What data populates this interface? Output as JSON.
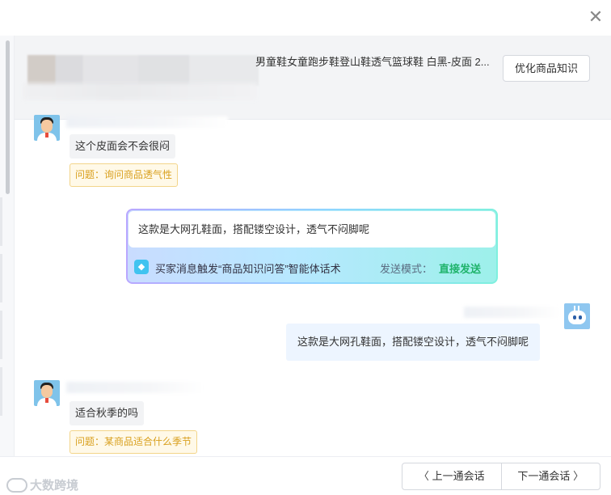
{
  "window": {
    "close_glyph": "✕"
  },
  "product": {
    "title": "男童鞋女童跑步鞋登山鞋透气篮球鞋 白黑-皮面 2...",
    "optimize_button": "优化商品知识"
  },
  "messages": [
    {
      "role": "customer",
      "text": "这个皮面会不会很闷",
      "tag": "问题：询问商品透气性"
    },
    {
      "role": "agent",
      "text": "这款是大网孔鞋面，搭配镂空设计，透气不闷脚呢"
    },
    {
      "role": "customer",
      "text": "适合秋季的吗",
      "tag": "问题：某商品适合什么季节"
    }
  ],
  "ai_suggestion": {
    "text": "这款是大网孔鞋面，搭配镂空设计，透气不闷脚呢",
    "trigger": "买家消息触发“商品知识问答”智能体话术",
    "mode_label": "发送模式：",
    "mode_value": "直接发送",
    "icon": "robot-icon"
  },
  "footer": {
    "prev_label": "上一通会话",
    "next_label": "下一通会话",
    "prev_glyph": "〈",
    "next_glyph": "〉",
    "watermark": "大数跨境"
  },
  "colors": {
    "tag_text": "#d9a01e",
    "tag_border": "#f3d58a",
    "mode_value": "#1fb36b",
    "agent_bubble": "#edf5ff"
  }
}
